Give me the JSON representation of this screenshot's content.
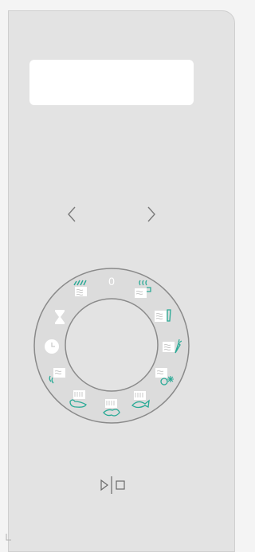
{
  "display": {
    "text": ""
  },
  "navigation": {
    "prev_icon": "chevron-left-icon",
    "next_icon": "chevron-right-icon"
  },
  "dial": {
    "zero_label": "0",
    "programs": [
      {
        "name": "hot-air-grill-program",
        "icon": "fan-grill-icon"
      },
      {
        "name": "keep-warm-program",
        "icon": "steam-cup-icon"
      },
      {
        "name": "drink-program",
        "icon": "glass-icon"
      },
      {
        "name": "vegetable-program",
        "icon": "carrot-icon"
      },
      {
        "name": "defrost-vegetable-program",
        "icon": "snow-vegetable-icon"
      },
      {
        "name": "fish-program",
        "icon": "fish-icon"
      },
      {
        "name": "meat-program",
        "icon": "meat-icon"
      },
      {
        "name": "poultry-program",
        "icon": "poultry-icon"
      },
      {
        "name": "soup-program",
        "icon": "bowl-icon"
      },
      {
        "name": "timer",
        "icon": "clock-icon"
      },
      {
        "name": "egg-timer",
        "icon": "hourglass-icon"
      },
      {
        "name": "microwave-grill-program",
        "icon": "microwave-grill-icon"
      }
    ]
  },
  "controls": {
    "start_stop_icon": "play-stop-icon"
  },
  "colors": {
    "accent": "#2aaa96",
    "panel": "#e3e3e3",
    "icon_white": "#ffffff",
    "ring": "#8a8a8a"
  }
}
